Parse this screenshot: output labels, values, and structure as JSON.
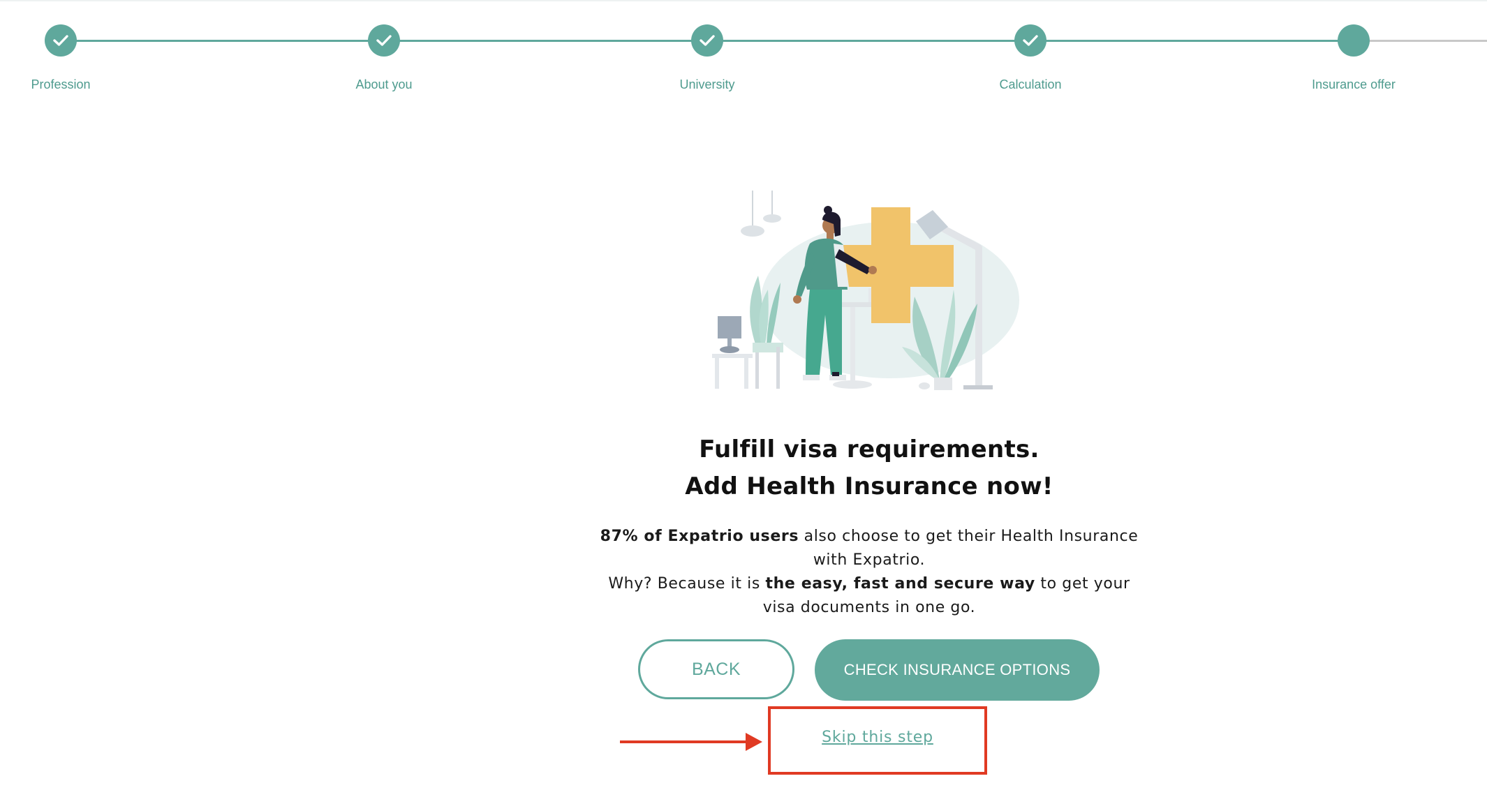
{
  "stepper": {
    "steps": [
      {
        "label": "Profession",
        "state": "completed"
      },
      {
        "label": "About you",
        "state": "completed"
      },
      {
        "label": "University",
        "state": "completed"
      },
      {
        "label": "Calculation",
        "state": "completed"
      },
      {
        "label": "Insurance offer",
        "state": "current"
      }
    ],
    "accent_color": "#5fa89c"
  },
  "main": {
    "headline_line1": "Fulfill visa requirements.",
    "headline_line2": "Add Health Insurance now!",
    "body": {
      "stat_bold": "87% of Expatrio users",
      "stat_rest": " also choose to get their Health Insurance with Expatrio.",
      "why_prefix": "Why? Because it is ",
      "why_bold": "the easy, fast and secure way",
      "why_suffix": " to get your visa documents in one go."
    },
    "back_label": "BACK",
    "primary_label": "CHECK INSURANCE OPTIONS",
    "skip_label": "Skip this step"
  },
  "annotation": {
    "highlight_color": "#e03a23"
  }
}
